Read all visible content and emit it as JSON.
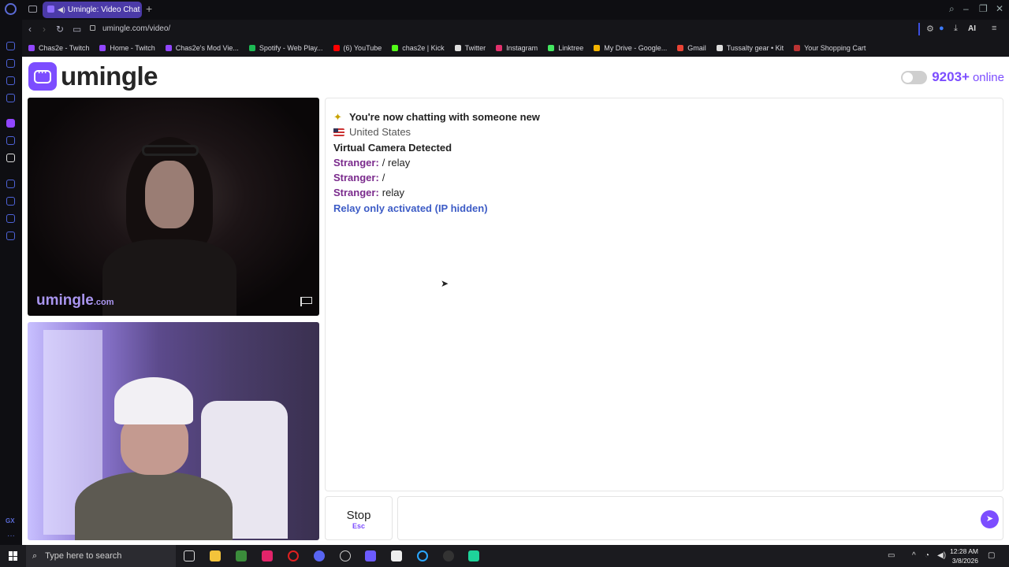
{
  "browser": {
    "tab_title": "Umingle: Video Chat w",
    "url": "umingle.com/video/",
    "ai_label": "AI"
  },
  "bookmarks": [
    {
      "label": "Chas2e - Twitch",
      "color": "#9146ff"
    },
    {
      "label": "Home - Twitch",
      "color": "#9146ff"
    },
    {
      "label": "Chas2e's Mod Vie...",
      "color": "#9146ff"
    },
    {
      "label": "Spotify - Web Play...",
      "color": "#1db954"
    },
    {
      "label": "(6) YouTube",
      "color": "#ff0000"
    },
    {
      "label": "chas2e | Kick",
      "color": "#53fc18"
    },
    {
      "label": "Twitter",
      "color": "#dddddd"
    },
    {
      "label": "Instagram",
      "color": "#e1306c"
    },
    {
      "label": "Linktree",
      "color": "#43e660"
    },
    {
      "label": "My Drive - Google...",
      "color": "#f4b400"
    },
    {
      "label": "Gmail",
      "color": "#ea4335"
    },
    {
      "label": "Tussalty gear • Kit",
      "color": "#dddddd"
    },
    {
      "label": "Your Shopping Cart",
      "color": "#b33"
    }
  ],
  "site": {
    "logo_text": "umingle",
    "online_count": "9203+",
    "online_label": "online",
    "watermark": "umingle",
    "watermark_suffix": ".com"
  },
  "chat": {
    "intro": "You're now chatting with someone new",
    "country": "United States",
    "notice": "Virtual Camera Detected",
    "messages": [
      {
        "who": "Stranger:",
        "text": "/ relay"
      },
      {
        "who": "Stranger:",
        "text": "/"
      },
      {
        "who": "Stranger:",
        "text": "relay"
      }
    ],
    "system": "Relay only activated (IP hidden)"
  },
  "controls": {
    "stop_label": "Stop",
    "stop_key": "Esc",
    "message_value": ""
  },
  "taskbar": {
    "search_placeholder": "Type here to search",
    "time": "12:28 AM",
    "date": "3/8/2026"
  },
  "colors": {
    "accent": "#7c4dff",
    "stranger": "#7a2a8c",
    "system": "#3d5cc6"
  }
}
